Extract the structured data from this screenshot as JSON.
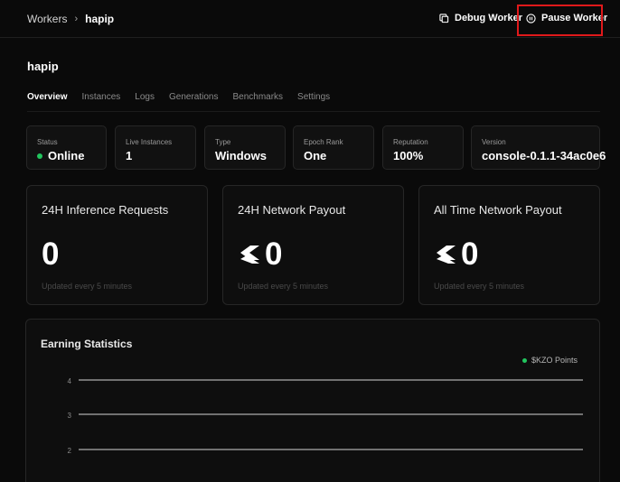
{
  "breadcrumb": {
    "root": "Workers",
    "separator": "›",
    "current": "hapip"
  },
  "toolbar": {
    "debug_label": "Debug Worker",
    "pause_label": "Pause Worker"
  },
  "worker": {
    "name": "hapip"
  },
  "tabs": [
    {
      "label": "Overview",
      "active": true
    },
    {
      "label": "Instances",
      "active": false
    },
    {
      "label": "Logs",
      "active": false
    },
    {
      "label": "Generations",
      "active": false
    },
    {
      "label": "Benchmarks",
      "active": false
    },
    {
      "label": "Settings",
      "active": false
    }
  ],
  "stats": [
    {
      "label": "Status",
      "value": "Online",
      "status_color": "#22c55e"
    },
    {
      "label": "Live Instances",
      "value": "1"
    },
    {
      "label": "Type",
      "value": "Windows"
    },
    {
      "label": "Epoch Rank",
      "value": "One"
    },
    {
      "label": "Reputation",
      "value": "100%"
    },
    {
      "label": "Version",
      "value": "console-0.1.1-34ac0e6"
    }
  ],
  "cards": [
    {
      "title": "24H Inference Requests",
      "value": "0",
      "updated": "Updated every 5 minutes",
      "icon": ""
    },
    {
      "title": "24H Network Payout",
      "value": "0",
      "updated": "Updated every 5 minutes",
      "icon": "kzo-token-icon"
    },
    {
      "title": "All Time Network Payout",
      "value": "0",
      "updated": "Updated every 5 minutes",
      "icon": "kzo-token-icon"
    }
  ],
  "earning": {
    "title": "Earning Statistics",
    "legend": "$KZO Points",
    "legend_color": "#22c55e"
  },
  "chart_data": {
    "type": "line",
    "title": "Earning Statistics",
    "series": [
      {
        "name": "$KZO Points",
        "values": []
      }
    ],
    "y_ticks": [
      "4",
      "3",
      "2"
    ],
    "legend": "top-right",
    "grid": true
  },
  "colors": {
    "background": "#0a0a0a",
    "card": "#0e0e0e",
    "border": "#262626",
    "accent_green": "#22c55e",
    "highlight": "#e0191b"
  }
}
